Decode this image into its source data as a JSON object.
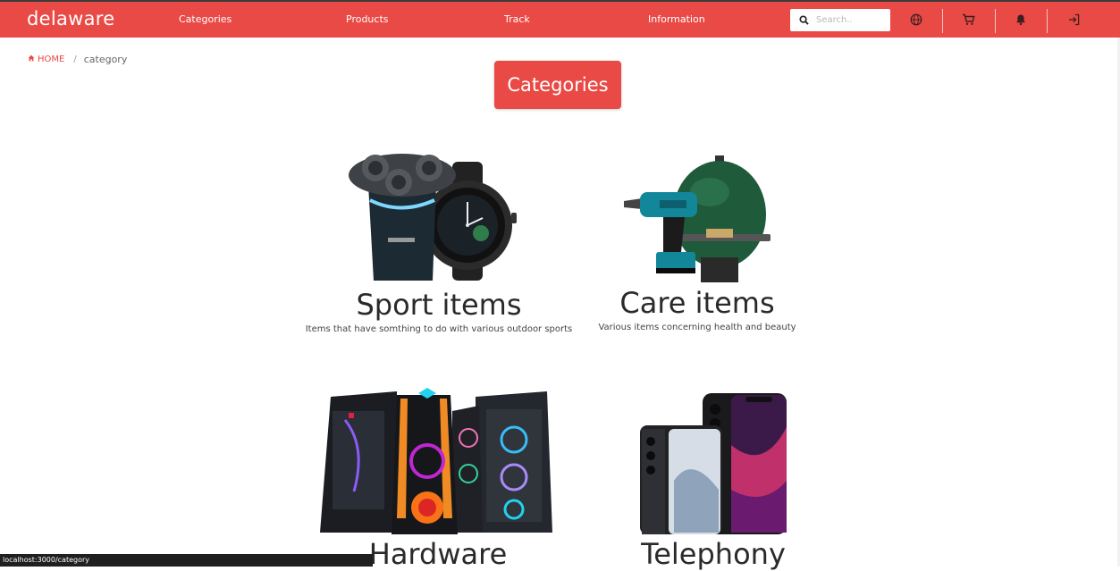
{
  "header": {
    "brand": "delaware",
    "nav": [
      {
        "label": "Categories"
      },
      {
        "label": "Products"
      },
      {
        "label": "Track"
      },
      {
        "label": "Information"
      }
    ],
    "search": {
      "placeholder": "Search..",
      "value": ""
    },
    "icons": [
      "globe-icon",
      "cart-icon",
      "notification-bell-icon",
      "sign-in-icon"
    ],
    "accent_color": "#e94a45"
  },
  "breadcrumb": {
    "home": "HOME",
    "separator": "/",
    "current": "category"
  },
  "page": {
    "title": "Categories"
  },
  "categories": [
    {
      "name": "Sport items",
      "description": "Items that have somthing to do with various outdoor sports"
    },
    {
      "name": "Care items",
      "description": "Various items concerning health and beauty"
    },
    {
      "name": "Hardware",
      "description": ""
    },
    {
      "name": "Telephony",
      "description": ""
    }
  ],
  "status_bar": {
    "url": "localhost:3000/category"
  }
}
